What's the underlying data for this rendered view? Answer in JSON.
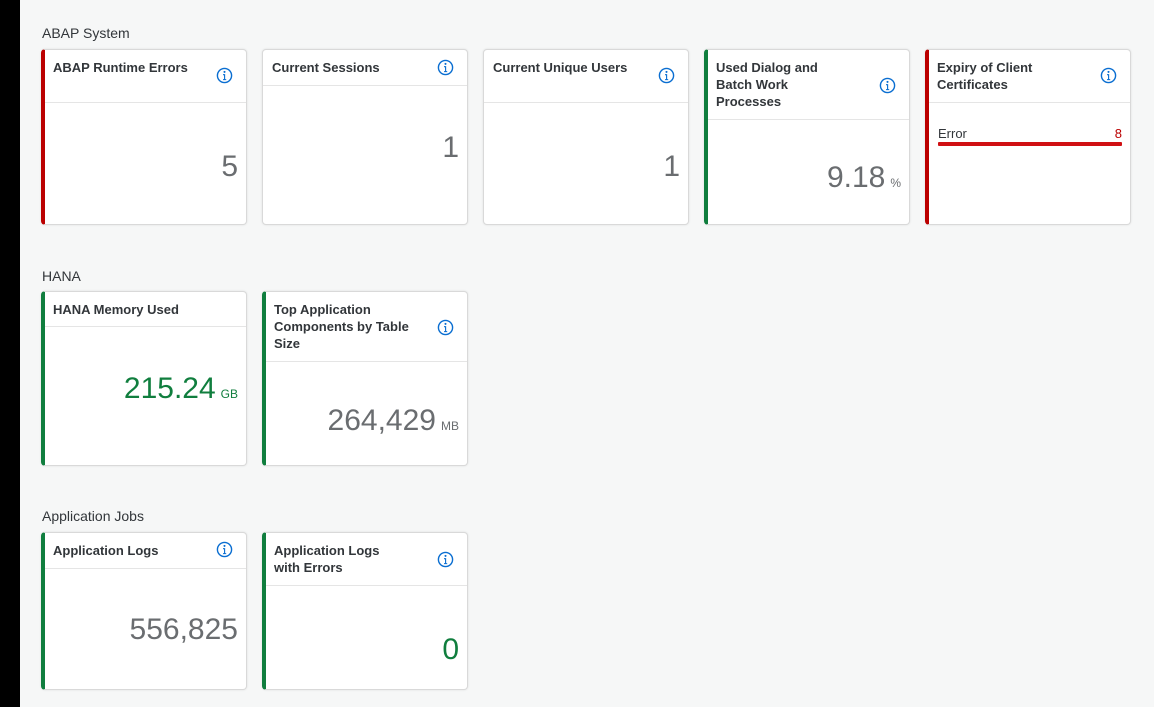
{
  "groups": {
    "abap": {
      "title": "ABAP System",
      "cards": {
        "runtime_errors": {
          "title": "ABAP Runtime Errors",
          "value": "5"
        },
        "current_sessions": {
          "title": "Current Sessions",
          "value": "1"
        },
        "unique_users": {
          "title": "Current Unique Users",
          "value": "1"
        },
        "work_processes": {
          "title": "Used Dialog and Batch Work Processes",
          "value": "9.18",
          "unit": "%"
        },
        "client_certificates": {
          "title": "Expiry of Client Certificates",
          "item_label": "Error",
          "item_value": "8",
          "bar_fraction": 1.0
        }
      }
    },
    "hana": {
      "title": "HANA",
      "cards": {
        "memory_used": {
          "title": "HANA Memory Used",
          "value": "215.24",
          "unit": "GB"
        },
        "top_components": {
          "title": "Top Application Components by Table Size",
          "value": "264,429",
          "unit": "MB"
        }
      }
    },
    "jobs": {
      "title": "Application Jobs",
      "cards": {
        "app_logs": {
          "title": "Application Logs",
          "value": "556,825"
        },
        "app_logs_errors": {
          "title": "Application Logs with Errors",
          "value": "0"
        }
      }
    }
  },
  "colors": {
    "error": "#bb0000",
    "success": "#107e3e",
    "neutral_value": "#6a6d70",
    "info_icon": "#0a6ed1",
    "background": "#f6f7f7"
  },
  "icons": {
    "info": "info-icon"
  }
}
